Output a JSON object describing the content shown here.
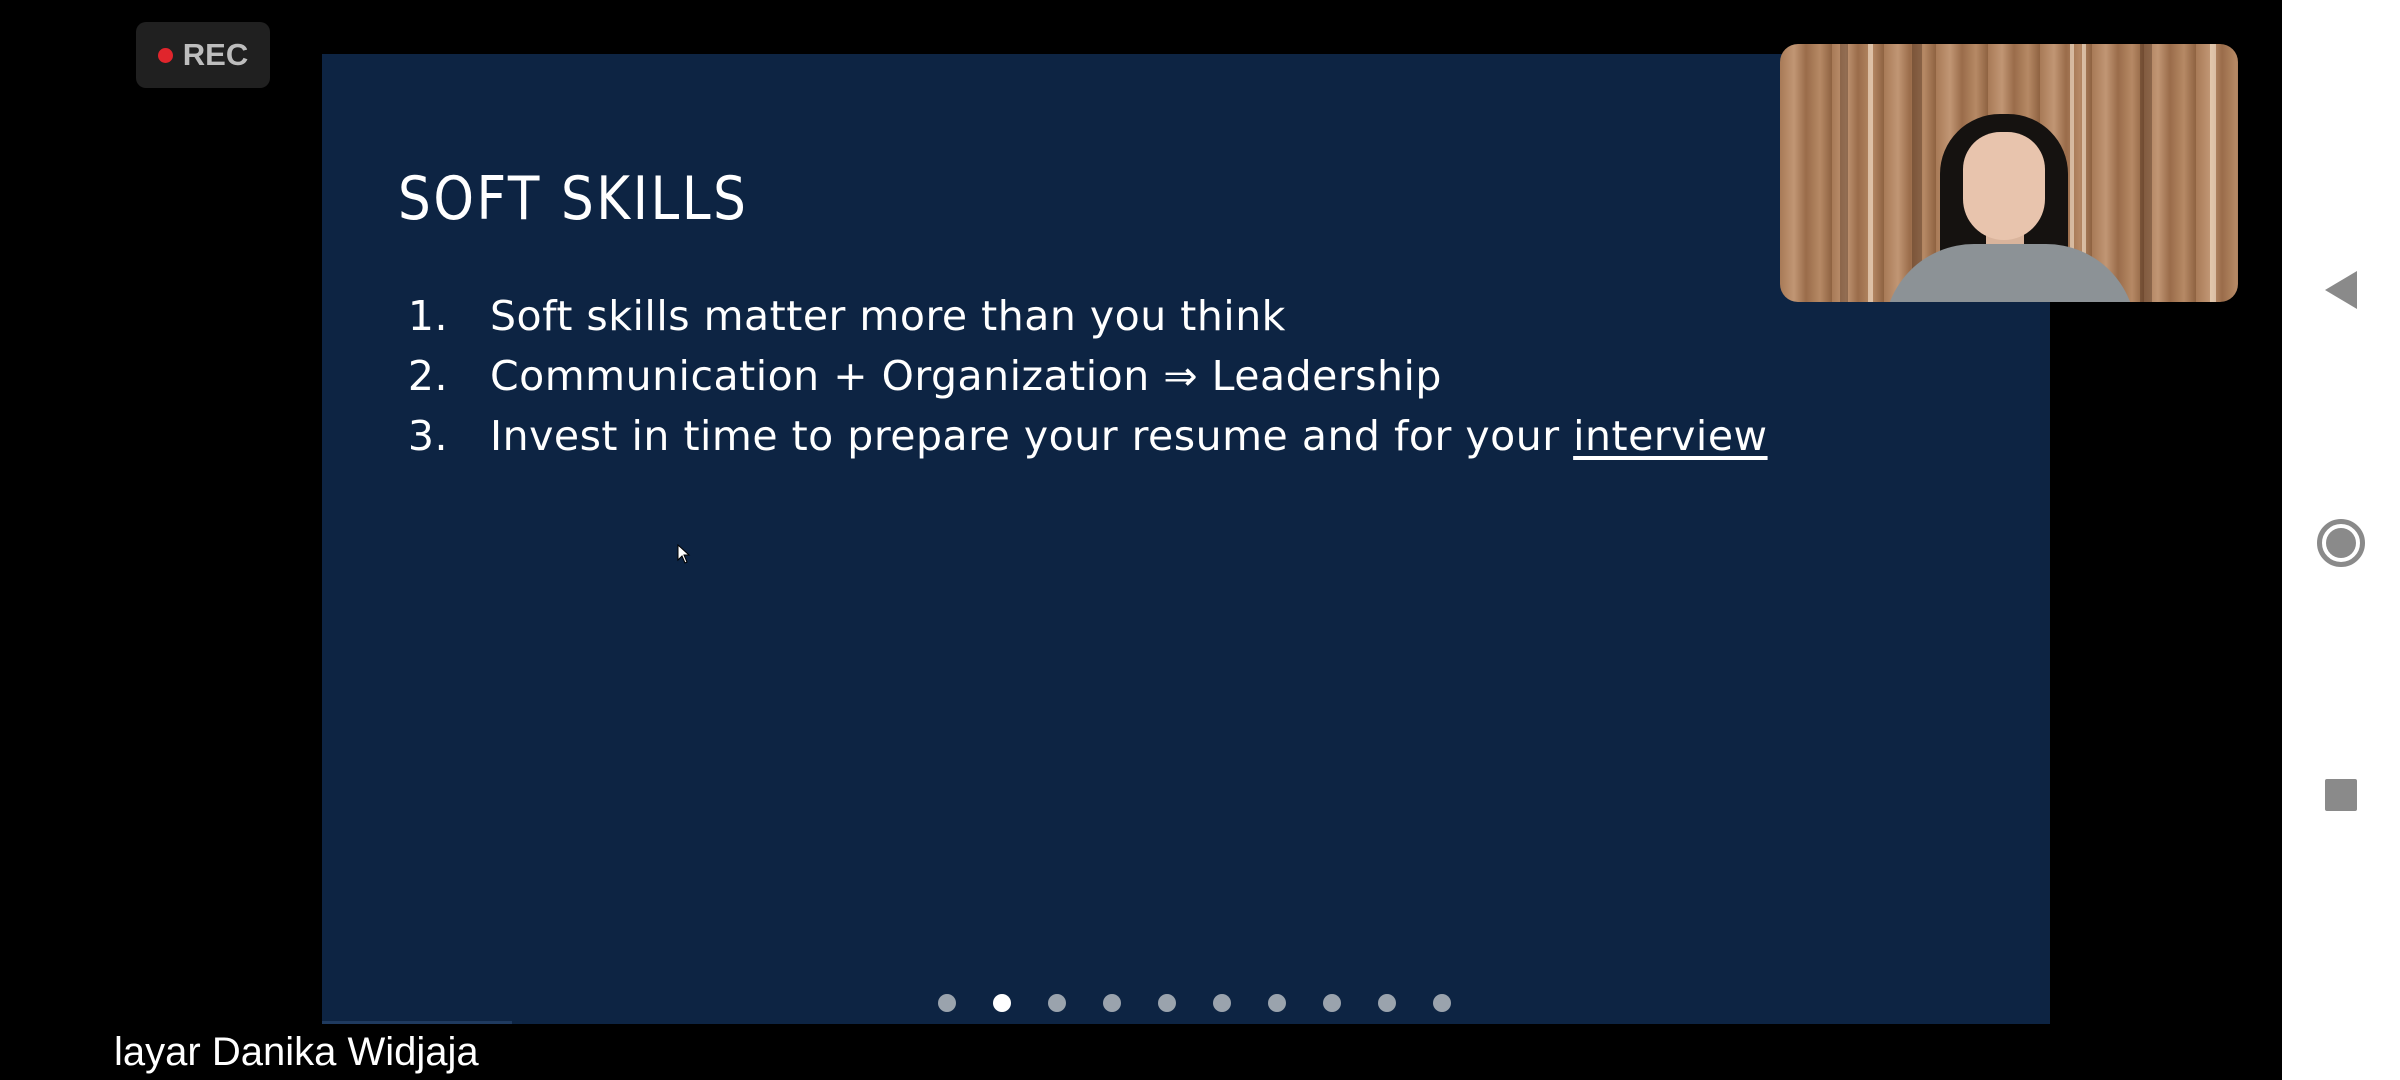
{
  "recording": {
    "label": "REC",
    "dot_color": "#e0252c"
  },
  "slide": {
    "title": "SOFT SKILLS",
    "background_color": "#0d2443",
    "items": [
      {
        "number": "1.",
        "text": "Soft skills matter more than you think",
        "link_text": ""
      },
      {
        "number": "2.",
        "text": "Communication + Organization ⇒ Leadership",
        "link_text": ""
      },
      {
        "number": "3.",
        "text": "Invest in time to prepare your resume and for your ",
        "link_text": "interview"
      }
    ],
    "dots": {
      "total": 10,
      "active_index": 1
    },
    "progress_fraction": 0.11
  },
  "video": {
    "participant": "Danika Widjaja"
  },
  "share_caption": "layar Danika Widjaja",
  "nav": {
    "back_icon": "back-triangle-icon",
    "home_icon": "home-circle-icon",
    "recents_icon": "recents-square-icon",
    "icon_color": "#8a8a8a"
  }
}
